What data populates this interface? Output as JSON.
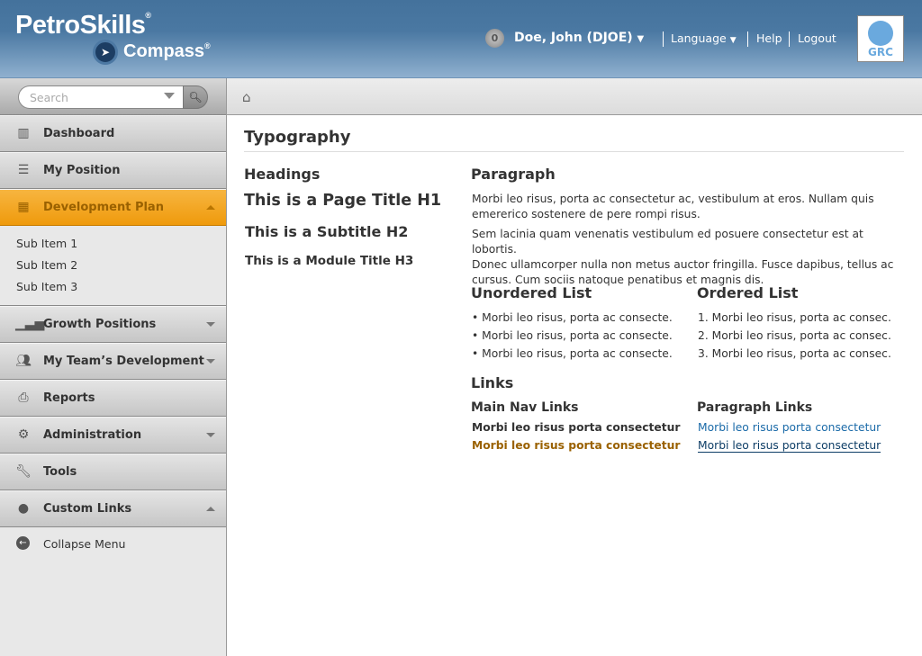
{
  "header": {
    "logo_main": "PetroSkills",
    "logo_sub": "Compass",
    "registered": "®",
    "notification_count": "0",
    "user_name": "Doe, John (DJOE)",
    "language_label": "Language",
    "help_label": "Help",
    "logout_label": "Logout",
    "grc_label": "GRC"
  },
  "search": {
    "placeholder": "Search"
  },
  "sidebar": {
    "items": [
      {
        "label": "Dashboard"
      },
      {
        "label": "My Position"
      },
      {
        "label": "Development Plan"
      },
      {
        "label": "Growth Positions"
      },
      {
        "label": "My Team’s Development"
      },
      {
        "label": "Reports"
      },
      {
        "label": "Administration"
      },
      {
        "label": "Tools"
      },
      {
        "label": "Custom Links"
      }
    ],
    "sub_items": [
      "Sub Item 1",
      "Sub Item 2",
      "Sub Item 3"
    ],
    "collapse_label": "Collapse Menu"
  },
  "main": {
    "title": "Typography",
    "headings": {
      "label": "Headings",
      "h1": "This is a Page Title H1",
      "h2": "This is a Subtitle H2",
      "h3": "This is a Module Title H3"
    },
    "paragraph": {
      "label": "Paragraph",
      "p1_line1": "Morbi leo risus, porta ac consectetur ac, vestibulum at eros. Nullam quis",
      "p1_line2": "emererico sostenere de pere rompi risus.",
      "p2_line1": "Sem lacinia quam venenatis vestibulum ed posuere consectetur est at lobortis.",
      "p2_line2": "Donec ullamcorper nulla non metus auctor fringilla. Fusce dapibus, tellus ac",
      "p2_line3": "cursus. Cum sociis natoque penatibus et magnis dis."
    },
    "unordered": {
      "label": "Unordered List",
      "items": [
        "• Morbi leo risus, porta ac consecte.",
        "• Morbi leo risus, porta ac consecte.",
        "• Morbi leo risus, porta ac consecte."
      ]
    },
    "ordered": {
      "label": "Ordered List",
      "items": [
        "1. Morbi leo risus, porta ac consec.",
        "2. Morbi leo risus, porta ac consec.",
        "3. Morbi leo risus, porta ac consec."
      ]
    },
    "links": {
      "label": "Links",
      "main_nav_label": "Main Nav Links",
      "main_nav": [
        "Morbi leo risus porta consectetur",
        "Morbi leo risus porta consectetur"
      ],
      "paragraph_label": "Paragraph Links",
      "paragraph": [
        "Morbi leo risus porta consectetur",
        "Morbi leo risus porta consectetur"
      ]
    }
  },
  "colors": {
    "accent": "#f0a020",
    "nav_hover": "#9a6100",
    "link": "#1a6aa8",
    "link_hover": "#0d3d66"
  }
}
